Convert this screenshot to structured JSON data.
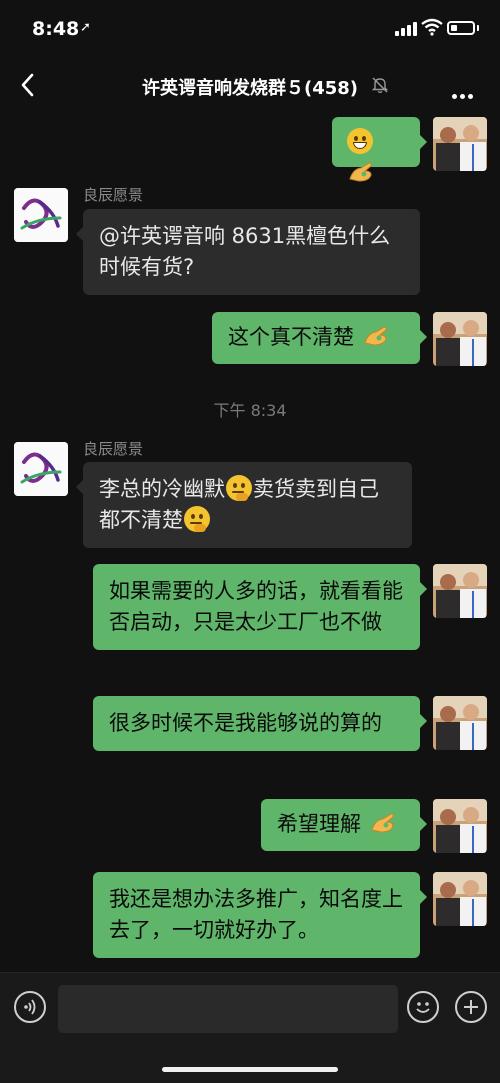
{
  "status": {
    "time": "8:48"
  },
  "header": {
    "title": "许英谔音响发烧群５(458)"
  },
  "messages": [
    {
      "side": "right",
      "text": ""
    },
    {
      "side": "left",
      "sender": "良辰愿景",
      "text": "@许英谔音响 8631黑檀色什么时候有货?"
    },
    {
      "side": "right",
      "text": "这个真不清楚"
    },
    {
      "side": "time",
      "text": "下午 8:34"
    },
    {
      "side": "left",
      "sender": "良辰愿景",
      "text_a": "李总的冷幽默",
      "text_b": "卖货卖到自己都不清楚"
    },
    {
      "side": "right",
      "text": "如果需要的人多的话，就看看能否启动，只是太少工厂也不做"
    },
    {
      "side": "right",
      "text": "很多时候不是我能够说的算的"
    },
    {
      "side": "right",
      "text": "希望理解"
    },
    {
      "side": "right",
      "text": "我还是想办法多推广，知名度上去了，一切就好办了。"
    }
  ],
  "icons": {
    "back": "chevron-left-icon",
    "mute": "bell-off-icon",
    "more": "more-dots-icon",
    "voice": "voice-icon",
    "emoji": "emoji-icon",
    "plus": "plus-icon"
  },
  "colors": {
    "my_bubble": "#5fb66a",
    "their_bubble": "#2c2c2c",
    "background": "#111111"
  }
}
